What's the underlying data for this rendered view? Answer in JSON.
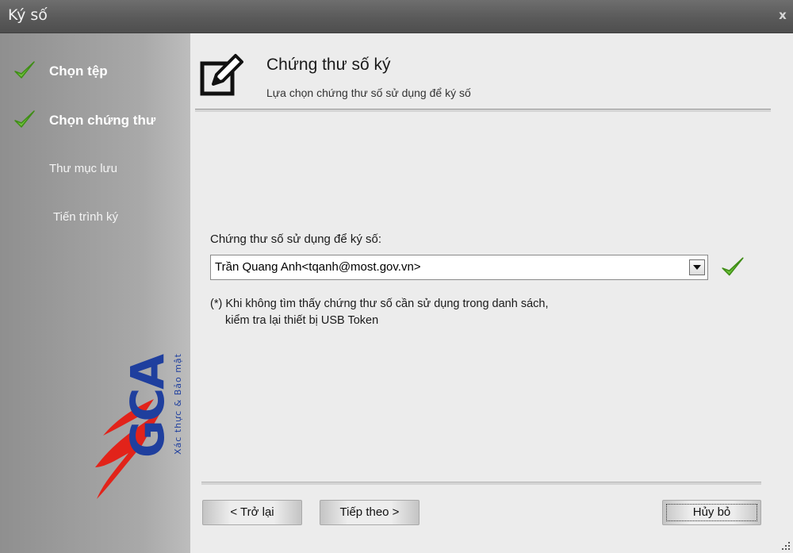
{
  "window": {
    "title": "Ký số",
    "close_label": "x"
  },
  "sidebar": {
    "steps": [
      {
        "label": "Chọn tệp",
        "status": "done"
      },
      {
        "label": "Chọn chứng thư",
        "status": "done"
      },
      {
        "label": "Thư mục lưu",
        "status": "pending"
      },
      {
        "label": "Tiến trình ký",
        "status": "pending"
      }
    ],
    "logo": {
      "mark": "VGCA",
      "tagline": "Xác thực & Bảo mật"
    }
  },
  "header": {
    "icon": "edit-document-icon",
    "title": "Chứng thư số ký",
    "subtitle": "Lựa chọn chứng thư số sử dụng để ký số"
  },
  "form": {
    "certificate_label": "Chứng thư số sử dụng để ký số:",
    "certificate_value": "Trần Quang Anh<tqanh@most.gov.vn>",
    "certificate_valid": true,
    "note_line1": "(*) Khi không tìm thấy chứng thư số cần sử dụng trong danh sách,",
    "note_line2": "kiểm tra lại thiết bị USB Token"
  },
  "buttons": {
    "back": "< Trở lại",
    "next": "Tiếp theo >",
    "cancel": "Hủy bỏ"
  },
  "colors": {
    "titlebar": "#5a5a5a",
    "sidebar": "#a0a0a0",
    "check_green": "#4fae1c",
    "logo_blue": "#1f3f9e",
    "logo_red": "#e2231a"
  }
}
